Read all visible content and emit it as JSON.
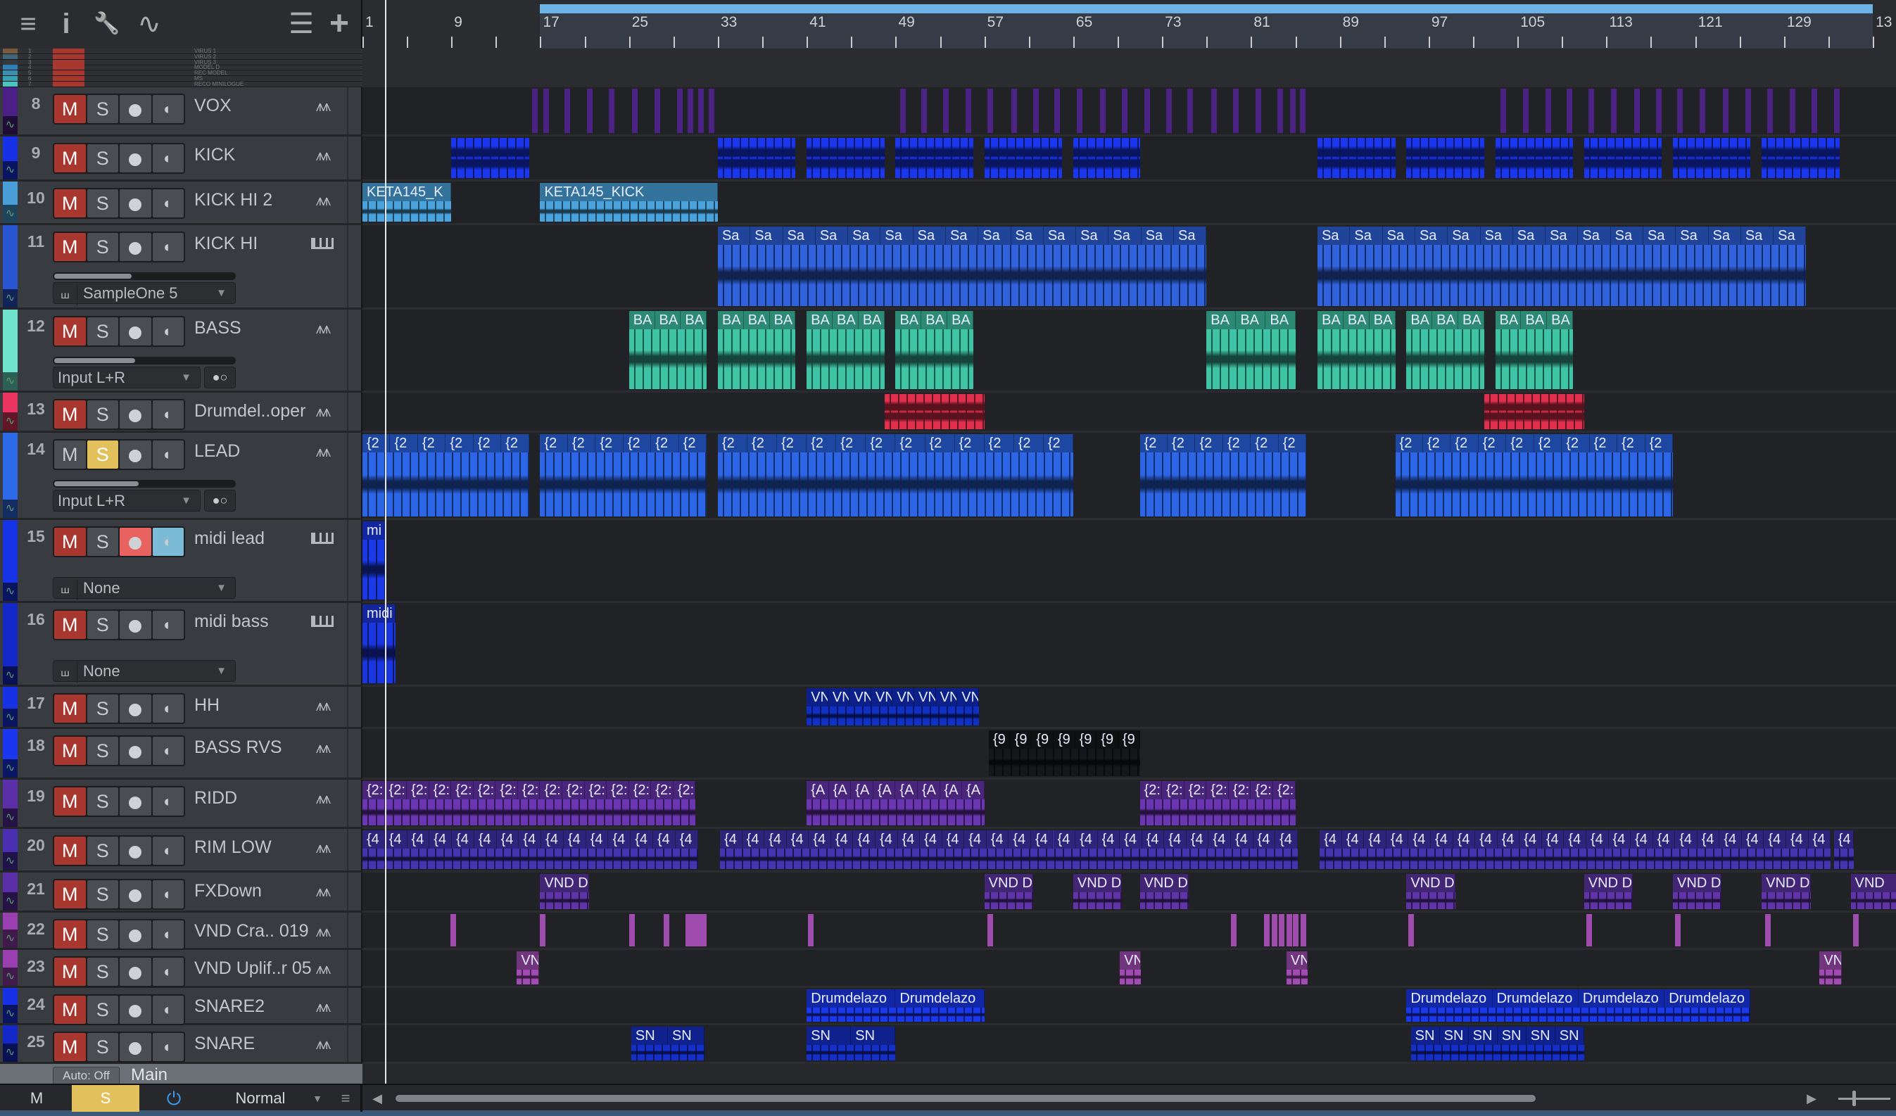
{
  "toolbar": {
    "menu_icon": "≡",
    "info_icon": "i",
    "wrench_icon": "🔧",
    "automation_icon": "∿",
    "list_icon": "☰",
    "add_icon": "+"
  },
  "ruler": {
    "labels": [
      "1",
      "9",
      "17",
      "25",
      "33",
      "41",
      "49",
      "57",
      "65",
      "73",
      "81",
      "89",
      "97",
      "105",
      "113",
      "121",
      "129",
      "13"
    ],
    "loop_start_bar": 17,
    "loop_end_bar": 137,
    "playhead_bar": 3
  },
  "small_tracks": [
    {
      "num": "1",
      "name": "VIRUS 1",
      "color": "#7a5a3c"
    },
    {
      "num": "2",
      "name": "VIRUS 2",
      "color": "#3f6577"
    },
    {
      "num": "3",
      "name": "VIRUS 3",
      "color": "#33393f"
    },
    {
      "num": "4",
      "name": "MODEL D",
      "color": "#2f7fb7"
    },
    {
      "num": "5",
      "name": "REC MODEL",
      "color": "#3b8fad"
    },
    {
      "num": "6",
      "name": "MS",
      "color": "#37a0b3"
    },
    {
      "num": "7",
      "name": "RECO MINILOGUE",
      "color": "#4cc5c2"
    }
  ],
  "tracks": [
    {
      "num": "8",
      "name": "VOX",
      "color": "#4a1f86",
      "clip_color": "#4b2384",
      "icon": "wave",
      "mute": true,
      "hits": [
        16.3,
        17.3,
        19.2,
        21.2,
        23.2,
        25.3,
        27.3,
        29.3,
        30.3,
        31.2,
        32.2,
        49.4,
        51.3,
        53.3,
        55.3,
        57.3,
        59.4,
        61.4,
        63.3,
        65.3,
        67.4,
        69.4,
        71.4,
        73.4,
        75.3,
        77.4,
        79.4,
        81.4,
        83.4,
        84.5,
        85.4,
        103.5,
        105.5,
        107.5,
        109.4,
        111.4,
        113.4,
        115.5,
        117.5,
        119.4,
        121.4,
        123.5,
        125.5,
        127.5,
        129.5,
        131.5,
        133.5
      ]
    },
    {
      "num": "9",
      "name": "KICK",
      "color": "#1732e6",
      "clip_color": "#1a36ee",
      "icon": "wave",
      "mute": true,
      "clips": [
        {
          "s": 9,
          "l": 7
        },
        {
          "s": 33,
          "l": 7
        },
        {
          "s": 41,
          "l": 7
        },
        {
          "s": 49,
          "l": 7
        },
        {
          "s": 57,
          "l": 7
        },
        {
          "s": 65,
          "l": 6
        },
        {
          "s": 87,
          "l": 7
        },
        {
          "s": 95,
          "l": 7
        },
        {
          "s": 103,
          "l": 7
        },
        {
          "s": 111,
          "l": 7
        },
        {
          "s": 119,
          "l": 7
        },
        {
          "s": 127,
          "l": 7
        }
      ]
    },
    {
      "num": "10",
      "name": "KICK HI 2",
      "color": "#4a9fd9",
      "clip_color": "#4aa3dc",
      "icon": "wave",
      "mute": true,
      "clips": [
        {
          "s": 1,
          "l": 8,
          "label": "KETA145_K",
          "n": 1
        },
        {
          "s": 17,
          "l": 16,
          "label": "KETA145_KICK",
          "n": 1
        }
      ]
    },
    {
      "num": "11",
      "name": "KICK HI",
      "color": "#2a55d2",
      "clip_color": "#2f62dc",
      "icon": "keys",
      "mute": true,
      "fader": 0.43,
      "sub": {
        "type": "instrument",
        "value": "SampleOne 5"
      },
      "clips": [
        {
          "s": 33,
          "l": 44,
          "label": "Sa",
          "n": 15
        },
        {
          "s": 87,
          "l": 44,
          "label": "Sa",
          "n": 15
        }
      ]
    },
    {
      "num": "12",
      "name": "BASS",
      "color": "#6fe3cb",
      "clip_color": "#3fc4a6",
      "icon": "wave",
      "mute": true,
      "fader": 0.45,
      "sub": {
        "type": "input",
        "value": "Input L+R"
      },
      "clips": [
        {
          "s": 25,
          "l": 7,
          "label": "BA",
          "n": 3
        },
        {
          "s": 33,
          "l": 7,
          "label": "BA",
          "n": 3
        },
        {
          "s": 41,
          "l": 7,
          "label": "BA",
          "n": 3
        },
        {
          "s": 49,
          "l": 7,
          "label": "BA",
          "n": 3
        },
        {
          "s": 77,
          "l": 8,
          "label": "BA",
          "n": 3
        },
        {
          "s": 87,
          "l": 7,
          "label": "BA",
          "n": 3
        },
        {
          "s": 95,
          "l": 7,
          "label": "BA",
          "n": 3
        },
        {
          "s": 103,
          "l": 7,
          "label": "BA",
          "n": 3
        }
      ]
    },
    {
      "num": "13",
      "name": "Drumdel..oper",
      "color": "#e8345e",
      "clip_color": "#e0304d",
      "icon": "wave",
      "mute": true,
      "clips": [
        {
          "s": 48,
          "l": 9
        },
        {
          "s": 102,
          "l": 9
        }
      ]
    },
    {
      "num": "14",
      "name": "LEAD",
      "color": "#2d6ae8",
      "clip_color": "#2c66e6",
      "icon": "wave",
      "solo": true,
      "fader": 0.47,
      "sub": {
        "type": "input",
        "value": "Input L+R"
      },
      "clips": [
        {
          "s": 1,
          "l": 15,
          "label": "{2",
          "n": 6
        },
        {
          "s": 17,
          "l": 15,
          "label": "{2",
          "n": 6
        },
        {
          "s": 33,
          "l": 32,
          "label": "{2",
          "n": 12
        },
        {
          "s": 71,
          "l": 15,
          "label": "{2",
          "n": 6
        },
        {
          "s": 94,
          "l": 25,
          "label": "{2",
          "n": 10
        }
      ]
    },
    {
      "num": "15",
      "name": "midi lead",
      "color": "#1733e6",
      "clip_color": "#1a3ae8",
      "icon": "keys",
      "mute": true,
      "rec": true,
      "mon": true,
      "sub": {
        "type": "instrument",
        "value": "None"
      },
      "clips": [
        {
          "s": 1,
          "l": 2,
          "label": "mi",
          "n": 1
        }
      ]
    },
    {
      "num": "16",
      "name": "midi bass",
      "color": "#1428c8",
      "clip_color": "#1a36e0",
      "icon": "keys",
      "mute": true,
      "sub": {
        "type": "instrument",
        "value": "None"
      },
      "clips": [
        {
          "s": 1,
          "l": 3,
          "label": "midi",
          "n": 1
        }
      ]
    },
    {
      "num": "17",
      "name": "HH",
      "color": "#1732e6",
      "clip_color": "#1030c4",
      "icon": "wave",
      "mute": true,
      "clips": [
        {
          "s": 41,
          "l": 15.5,
          "label": "VN",
          "n": 8
        }
      ]
    },
    {
      "num": "18",
      "name": "BASS RVS",
      "color": "#1a36ee",
      "clip_color": "#15171a",
      "icon": "wave",
      "mute": true,
      "clips": [
        {
          "s": 57.4,
          "l": 13.6,
          "label": "{9",
          "n": 7
        }
      ]
    },
    {
      "num": "19",
      "name": "RIDD",
      "color": "#5a2fa8",
      "clip_color": "#6a36b2",
      "icon": "wave",
      "mute": true,
      "clips": [
        {
          "s": 1,
          "l": 30,
          "label": "{2:",
          "n": 15
        },
        {
          "s": 41,
          "l": 16,
          "label": "{A",
          "n": 8
        },
        {
          "s": 71,
          "l": 14,
          "label": "{2:",
          "n": 7
        }
      ]
    },
    {
      "num": "20",
      "name": "RIM LOW",
      "color": "#4a2fb0",
      "clip_color": "#4434b0",
      "icon": "wave",
      "mute": true,
      "clips": [
        {
          "s": 1,
          "l": 30.2,
          "label": "{4",
          "n": 15
        },
        {
          "s": 33.2,
          "l": 52,
          "label": "{4",
          "n": 26
        },
        {
          "s": 87.2,
          "l": 46,
          "label": "{4",
          "n": 23
        },
        {
          "s": 133.5,
          "l": 1.8,
          "label": "{4",
          "n": 1
        }
      ]
    },
    {
      "num": "21",
      "name": "FXDown",
      "color": "#5a2fa8",
      "clip_color": "#6035a8",
      "icon": "wave",
      "mute": true,
      "clips": [
        {
          "s": 17,
          "l": 4.4,
          "label": "VND D",
          "n": 1
        },
        {
          "s": 57,
          "l": 4.4,
          "label": "VND D",
          "n": 1
        },
        {
          "s": 65,
          "l": 4.4,
          "label": "VND D",
          "n": 1
        },
        {
          "s": 71,
          "l": 4.4,
          "label": "VND D",
          "n": 1
        },
        {
          "s": 95,
          "l": 4.4,
          "label": "VND D",
          "n": 1
        },
        {
          "s": 111,
          "l": 4.4,
          "label": "VND D",
          "n": 1
        },
        {
          "s": 119,
          "l": 4.4,
          "label": "VND D",
          "n": 1
        },
        {
          "s": 127,
          "l": 4.4,
          "label": "VND D",
          "n": 1
        },
        {
          "s": 135,
          "l": 4.4,
          "label": "VND",
          "n": 1
        }
      ]
    },
    {
      "num": "22",
      "name": "VND Cra.. 019",
      "color": "#9a3fb0",
      "clip_color": "#a04cae",
      "icon": "wave",
      "mute": true,
      "hits": [
        8.9,
        17,
        25,
        28.1,
        30.1,
        30.6,
        31,
        31.5,
        41.1,
        57.3,
        79.2,
        82.2,
        82.9,
        83.5,
        84.2,
        84.8,
        85.5,
        95.2,
        111.2,
        119.2,
        127.3,
        135.2
      ]
    },
    {
      "num": "23",
      "name": "VND Uplif..r 05",
      "color": "#9a3fb0",
      "clip_color": "#a14cb3",
      "icon": "wave",
      "mute": true,
      "clips": [
        {
          "s": 14.9,
          "l": 2,
          "label": "VN",
          "n": 1
        },
        {
          "s": 69.2,
          "l": 1.9,
          "label": "VN",
          "n": 1
        },
        {
          "s": 84.2,
          "l": 1.9,
          "label": "VN",
          "n": 1
        },
        {
          "s": 132.2,
          "l": 2,
          "label": "VN",
          "n": 1
        }
      ]
    },
    {
      "num": "24",
      "name": "SNARE2",
      "color": "#1732e6",
      "clip_color": "#1a38ec",
      "icon": "wave",
      "mute": true,
      "clips": [
        {
          "s": 41,
          "l": 16,
          "label": "Drumdelazo",
          "n": 2
        },
        {
          "s": 95,
          "l": 31,
          "label": "Drumdelazo",
          "n": 4
        }
      ]
    },
    {
      "num": "25",
      "name": "SNARE",
      "color": "#1428c8",
      "clip_color": "#1530c8",
      "icon": "wave",
      "mute": true,
      "clips": [
        {
          "s": 25.2,
          "l": 6.6,
          "label": "SN",
          "n": 2
        },
        {
          "s": 41,
          "l": 8,
          "label": "SN",
          "n": 2
        },
        {
          "s": 95.4,
          "l": 15.6,
          "label": "SN",
          "n": 6
        }
      ]
    }
  ],
  "buttons": {
    "mute": "M",
    "solo": "S"
  },
  "main_row": {
    "auto_label": "Auto: Off",
    "name": "Main"
  },
  "bottom": {
    "mute_all": "M",
    "solo_all": "S",
    "mode": "Normal",
    "mode_arrow": "▼",
    "menu_icon": "≡",
    "scroll_left": "◀",
    "scroll_right": "▶"
  }
}
